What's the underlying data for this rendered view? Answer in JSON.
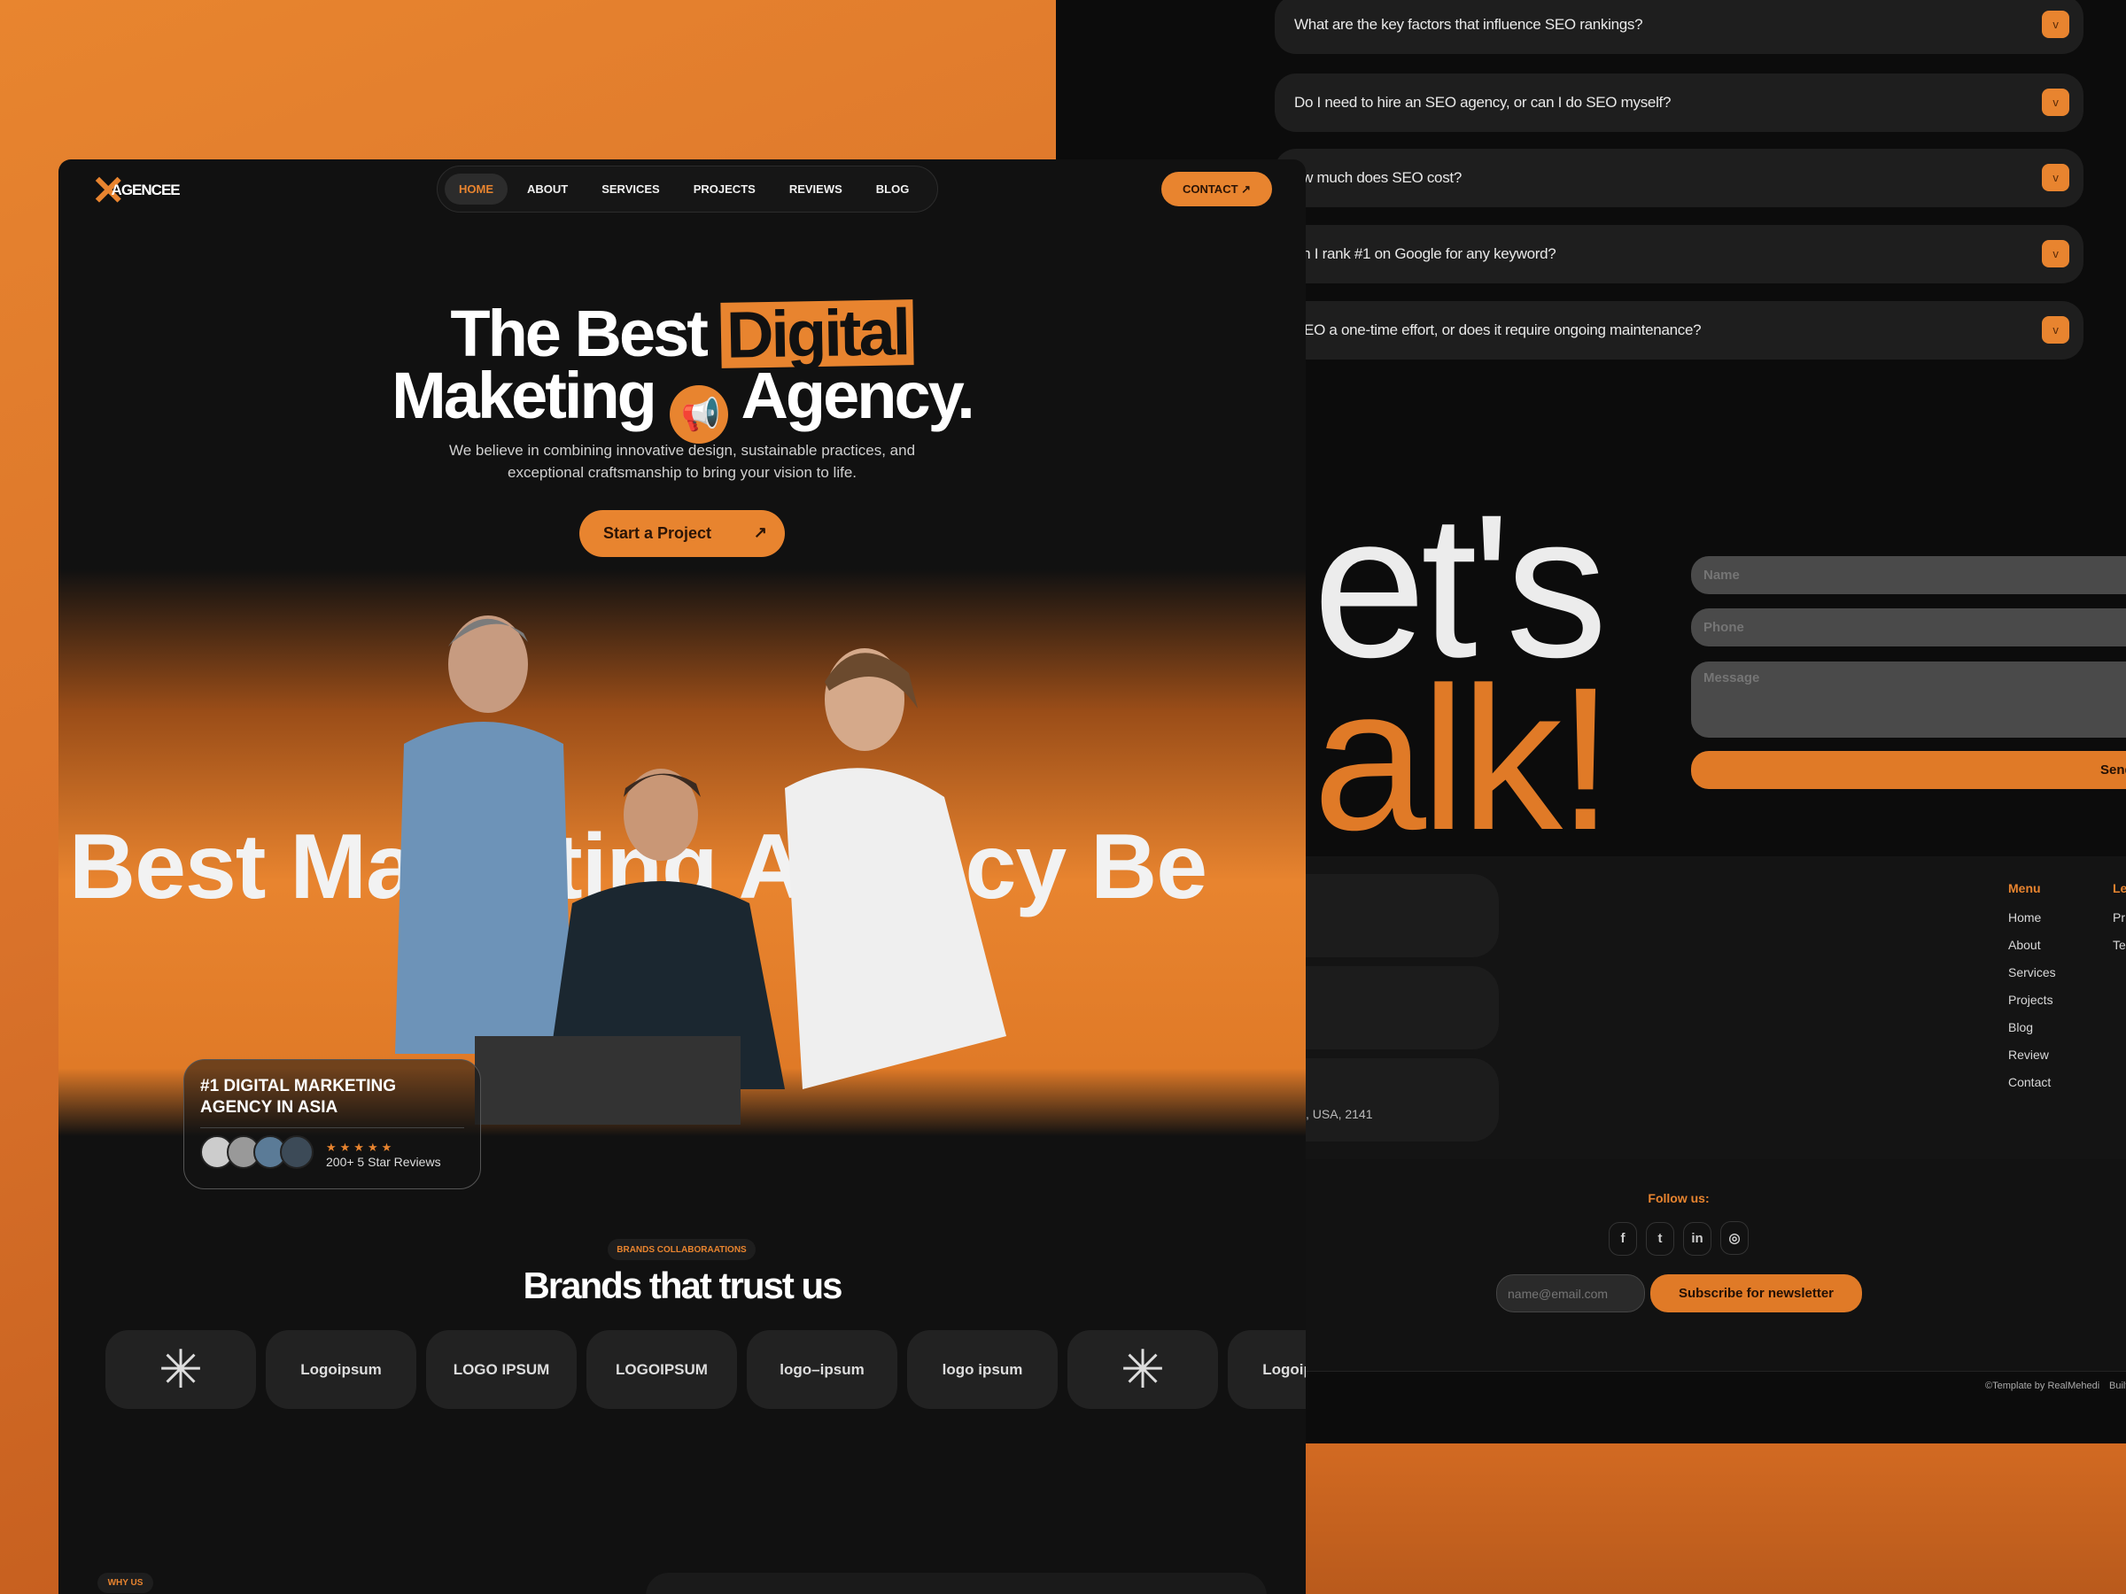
{
  "colors": {
    "accent": "#e8842f",
    "background": "#111111",
    "panel": "#1e1e1e"
  },
  "faq": [
    {
      "q": "What are the key factors that influence SEO rankings?",
      "icon": "chevron-down-icon"
    },
    {
      "q": "Do I need to hire an SEO agency, or can I do SEO myself?",
      "icon": "chevron-down-icon"
    },
    {
      "q": "ow much does SEO cost?",
      "icon": "chevron-down-icon"
    },
    {
      "q": "an I rank #1 on Google for any keyword?",
      "icon": "chevron-down-icon"
    },
    {
      "q": "SEO a one-time effort, or does it require ongoing maintenance?",
      "icon": "chevron-down-icon"
    }
  ],
  "contact": {
    "line1": "et's",
    "line2": "alk!",
    "name_placeholder": "Name",
    "phone_placeholder": "Phone",
    "message_placeholder": "Message",
    "send": "Send"
  },
  "footer": {
    "address": ", USA, 2141",
    "menu_title": "Menu",
    "menu": [
      "Home",
      "About",
      "Services",
      "Projects",
      "Blog",
      "Review",
      "Contact"
    ],
    "legal_title": "Le",
    "legal": [
      "Pr",
      "Te"
    ],
    "follow": "Follow us:",
    "social": [
      "facebook-icon",
      "twitter-icon",
      "linkedin-icon",
      "instagram-icon"
    ],
    "email_placeholder": "name@email.com",
    "subscribe": "Subscribe for newsletter",
    "copyright": "©Template by RealMehedi",
    "built": "Built"
  },
  "front": {
    "logo": "AGENCEE",
    "nav": [
      "HOME",
      "ABOUT",
      "SERVICES",
      "PROJECTS",
      "REVIEWS",
      "BLOG"
    ],
    "active_nav": "HOME",
    "contact": "CONTACT",
    "hero": {
      "l1a": "The Best ",
      "l1b": "Digital",
      "l2a": "Maketing ",
      "l2b": "Agency.",
      "sub1": "We believe in combining innovative design, sustainable practices, and",
      "sub2": "exceptional craftsmanship to bring your vision to life.",
      "cta": "Start a Project"
    },
    "marquee": "Best Marketing Agency  Be",
    "card": {
      "title1": "#1 DIGITAL MARKETING",
      "title2": "AGENCY IN ASIA",
      "stars": 5,
      "reviews": "200+ 5 Star Reviews"
    },
    "brands": {
      "pill": "BRANDS COLLABORAATIONS",
      "title": "Brands that trust us",
      "logos": [
        "asterisk-logo",
        "Logoipsum",
        "LOGO IPSUM",
        "LOGOIPSUM",
        "logo–ipsum",
        "logo ipsum",
        "asterisk-logo",
        "Logoipsum"
      ]
    },
    "why": "WHY US"
  }
}
